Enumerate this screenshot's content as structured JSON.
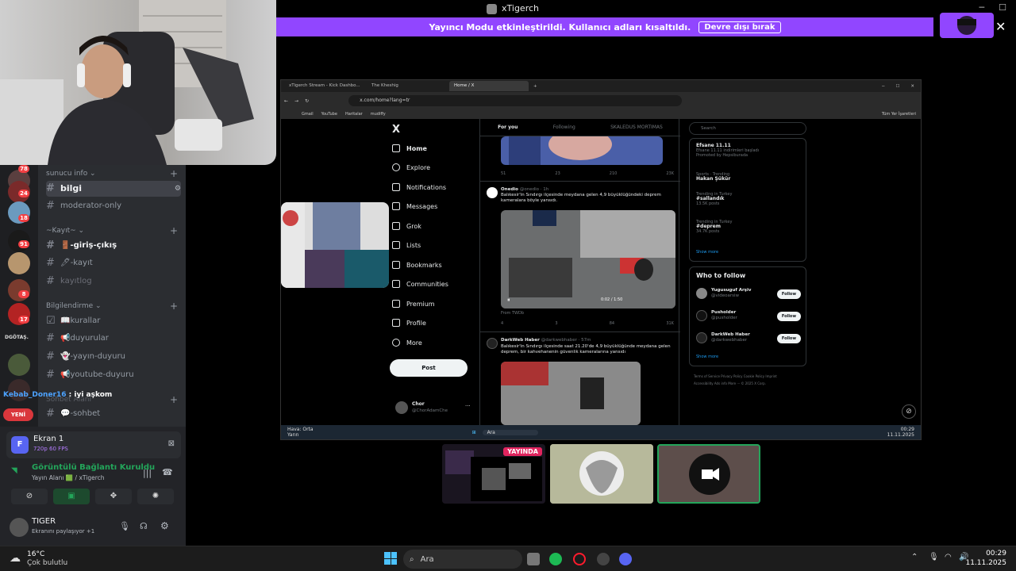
{
  "window": {
    "title": "xTigerch"
  },
  "banner": {
    "message": "Yayıncı Modu etkinleştirildi. Kullanıcı adları kısaltıldı.",
    "button": "Devre dışı bırak"
  },
  "discord": {
    "servers": [
      {
        "badge": "78"
      },
      {
        "badge": "24"
      },
      {
        "badge": "18"
      },
      {
        "badge": "91"
      },
      {
        "badge": ""
      },
      {
        "badge": "8"
      },
      {
        "badge": "17"
      },
      {
        "label": "DGÖTAŞ."
      },
      {
        "badge": ""
      },
      {
        "badge": ""
      }
    ],
    "new_label": "YENİ",
    "categories": [
      {
        "name": "sunucu info ⌄"
      },
      {
        "name": "~Kayıt~ ⌄"
      },
      {
        "name": "Bilgilendirme ⌄"
      },
      {
        "name": "Sohbet Alanı"
      }
    ],
    "channels": [
      {
        "name": "bilgi"
      },
      {
        "name": "moderator-only"
      },
      {
        "name": "🚪-giriş-çıkış"
      },
      {
        "name": "🖊-kayıt"
      },
      {
        "name": "kayıtlog"
      },
      {
        "name": "📖kurallar"
      },
      {
        "name": "📢duyurular"
      },
      {
        "name": "👻-yayın-duyuru"
      },
      {
        "name": "📢youtube-duyuru"
      },
      {
        "name": "💬-sohbet"
      }
    ],
    "chat_overlay": {
      "user": "Kebab_Doner16",
      "message": ": iyi aşkom"
    },
    "screen_share": {
      "title": "Ekran 1",
      "quality": "720p 60 FPS"
    },
    "voice": {
      "status": "Görüntülü Bağlantı Kuruldu",
      "channel": "Yayın Alanı 🟩 / xTigerch"
    },
    "user": {
      "name": "TIGER",
      "status": "Ekranını paylaşıyor +1"
    }
  },
  "browser": {
    "tabs": [
      "xTigerch Stream - Kick Dashbo...",
      "The Kheshig",
      "Home / X"
    ],
    "url": "x.com/home?lang=tr",
    "bookmarks": [
      "Gmail",
      "YouTube",
      "Haritalar",
      "mudiffy"
    ],
    "all_bookmarks": "Tüm Yer İşaretleri",
    "x": {
      "logo": "X",
      "nav": [
        "Home",
        "Explore",
        "Notifications",
        "Messages",
        "Grok",
        "Lists",
        "Bookmarks",
        "Communities",
        "Premium",
        "Profile",
        "More"
      ],
      "post_button": "Post",
      "account": {
        "name": "Chor",
        "handle": "@ChorAdamChe"
      },
      "feed_tabs": [
        "For you",
        "Following",
        "SKALEDUS MORTIMAS"
      ],
      "post1_actions": [
        "51",
        "23",
        "210",
        "23K"
      ],
      "post2": {
        "name": "Onedio",
        "handle": "@onedio · 1h",
        "text": "Balıkesir'in Sındırgı ilçesinde meydana gelen 4,9 büyüklüğündeki deprem kameralara böyle yansıdı.",
        "time": "0:02 / 1:50",
        "from": "From TWDb",
        "actions": [
          "4",
          "3",
          "84",
          "31K"
        ]
      },
      "post3": {
        "name": "DarkWeb Haber",
        "handle": "@darkwebhaber · 57m",
        "text": "Balıkesir'in Sındırgı ilçesinde saat 21.20'de 4,9 büyüklüğünde meydana gelen deprem, bir kahvehanenin güvenlik kameralarına yansıdı"
      },
      "search": "Search",
      "trends": [
        {
          "title": "Efsane 11.11",
          "sub": "Efsane 11.11 indirimleri başladı",
          "meta": "Promoted by Hepsiburada"
        },
        {
          "title": "Hakan Şükür",
          "sub": "Sports · Trending",
          "meta": ""
        },
        {
          "title": "#sallandık",
          "sub": "Trending in Turkey",
          "meta": "13.5K posts"
        },
        {
          "title": "#deprem",
          "sub": "Trending in Turkey",
          "meta": "34.7K posts"
        }
      ],
      "show_more": "Show more",
      "who_to_follow": "Who to follow",
      "follow_list": [
        {
          "name": "Yugusuguf Arşiv",
          "handle": "@videoarsiw"
        },
        {
          "name": "Pusholder",
          "handle": "@pusholder"
        },
        {
          "name": "DarkWeb Haber",
          "handle": "@darkwebhaber"
        }
      ],
      "follow_label": "Follow",
      "footer": "Terms of Service  Privacy Policy  Cookie Policy  Imprint  Accessibility  Ads info  More ···  © 2025 X Corp."
    },
    "taskbar": {
      "weather": "Hava: Orta",
      "weather_sub": "Yarın",
      "search": "Ara",
      "time": "00:29",
      "date": "11.11.2025"
    }
  },
  "thumbnails": {
    "live_label": "YAYINDA"
  },
  "taskbar": {
    "temp": "16°C",
    "weather": "Çok bulutlu",
    "search": "Ara",
    "time": "00:29",
    "date": "11.11.2025"
  },
  "colors": {
    "accent": "#9146ff",
    "discord_bg": "#2b2d31",
    "live_red": "#e0245e"
  }
}
